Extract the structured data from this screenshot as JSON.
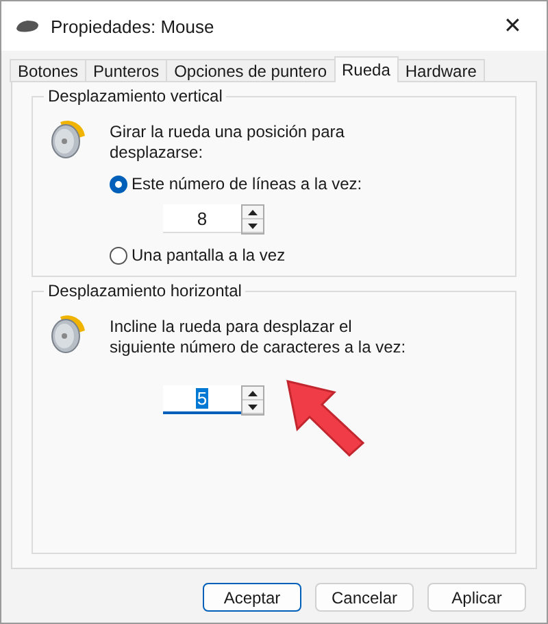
{
  "window": {
    "title": "Propiedades: Mouse",
    "close": "✕"
  },
  "tabs": [
    {
      "label": "Botones",
      "selected": false
    },
    {
      "label": "Punteros",
      "selected": false
    },
    {
      "label": "Opciones de puntero",
      "selected": false
    },
    {
      "label": "Rueda",
      "selected": true
    },
    {
      "label": "Hardware",
      "selected": false
    }
  ],
  "vertical": {
    "legend": "Desplazamiento vertical",
    "description": "Girar la rueda una posición para desplazarse:",
    "options": [
      {
        "label": "Este número de líneas a la vez:",
        "selected": true
      },
      {
        "label": "Una pantalla a la vez",
        "selected": false
      }
    ],
    "spinner": {
      "value": "8",
      "focused": false
    }
  },
  "horizontal": {
    "legend": "Desplazamiento horizontal",
    "description": "Incline la rueda para desplazar el siguiente número de caracteres a la vez:",
    "spinner": {
      "value": "5",
      "focused": true
    }
  },
  "buttons": [
    {
      "label": "Aceptar",
      "default": true
    },
    {
      "label": "Cancelar",
      "default": false
    },
    {
      "label": "Aplicar",
      "default": false
    }
  ]
}
